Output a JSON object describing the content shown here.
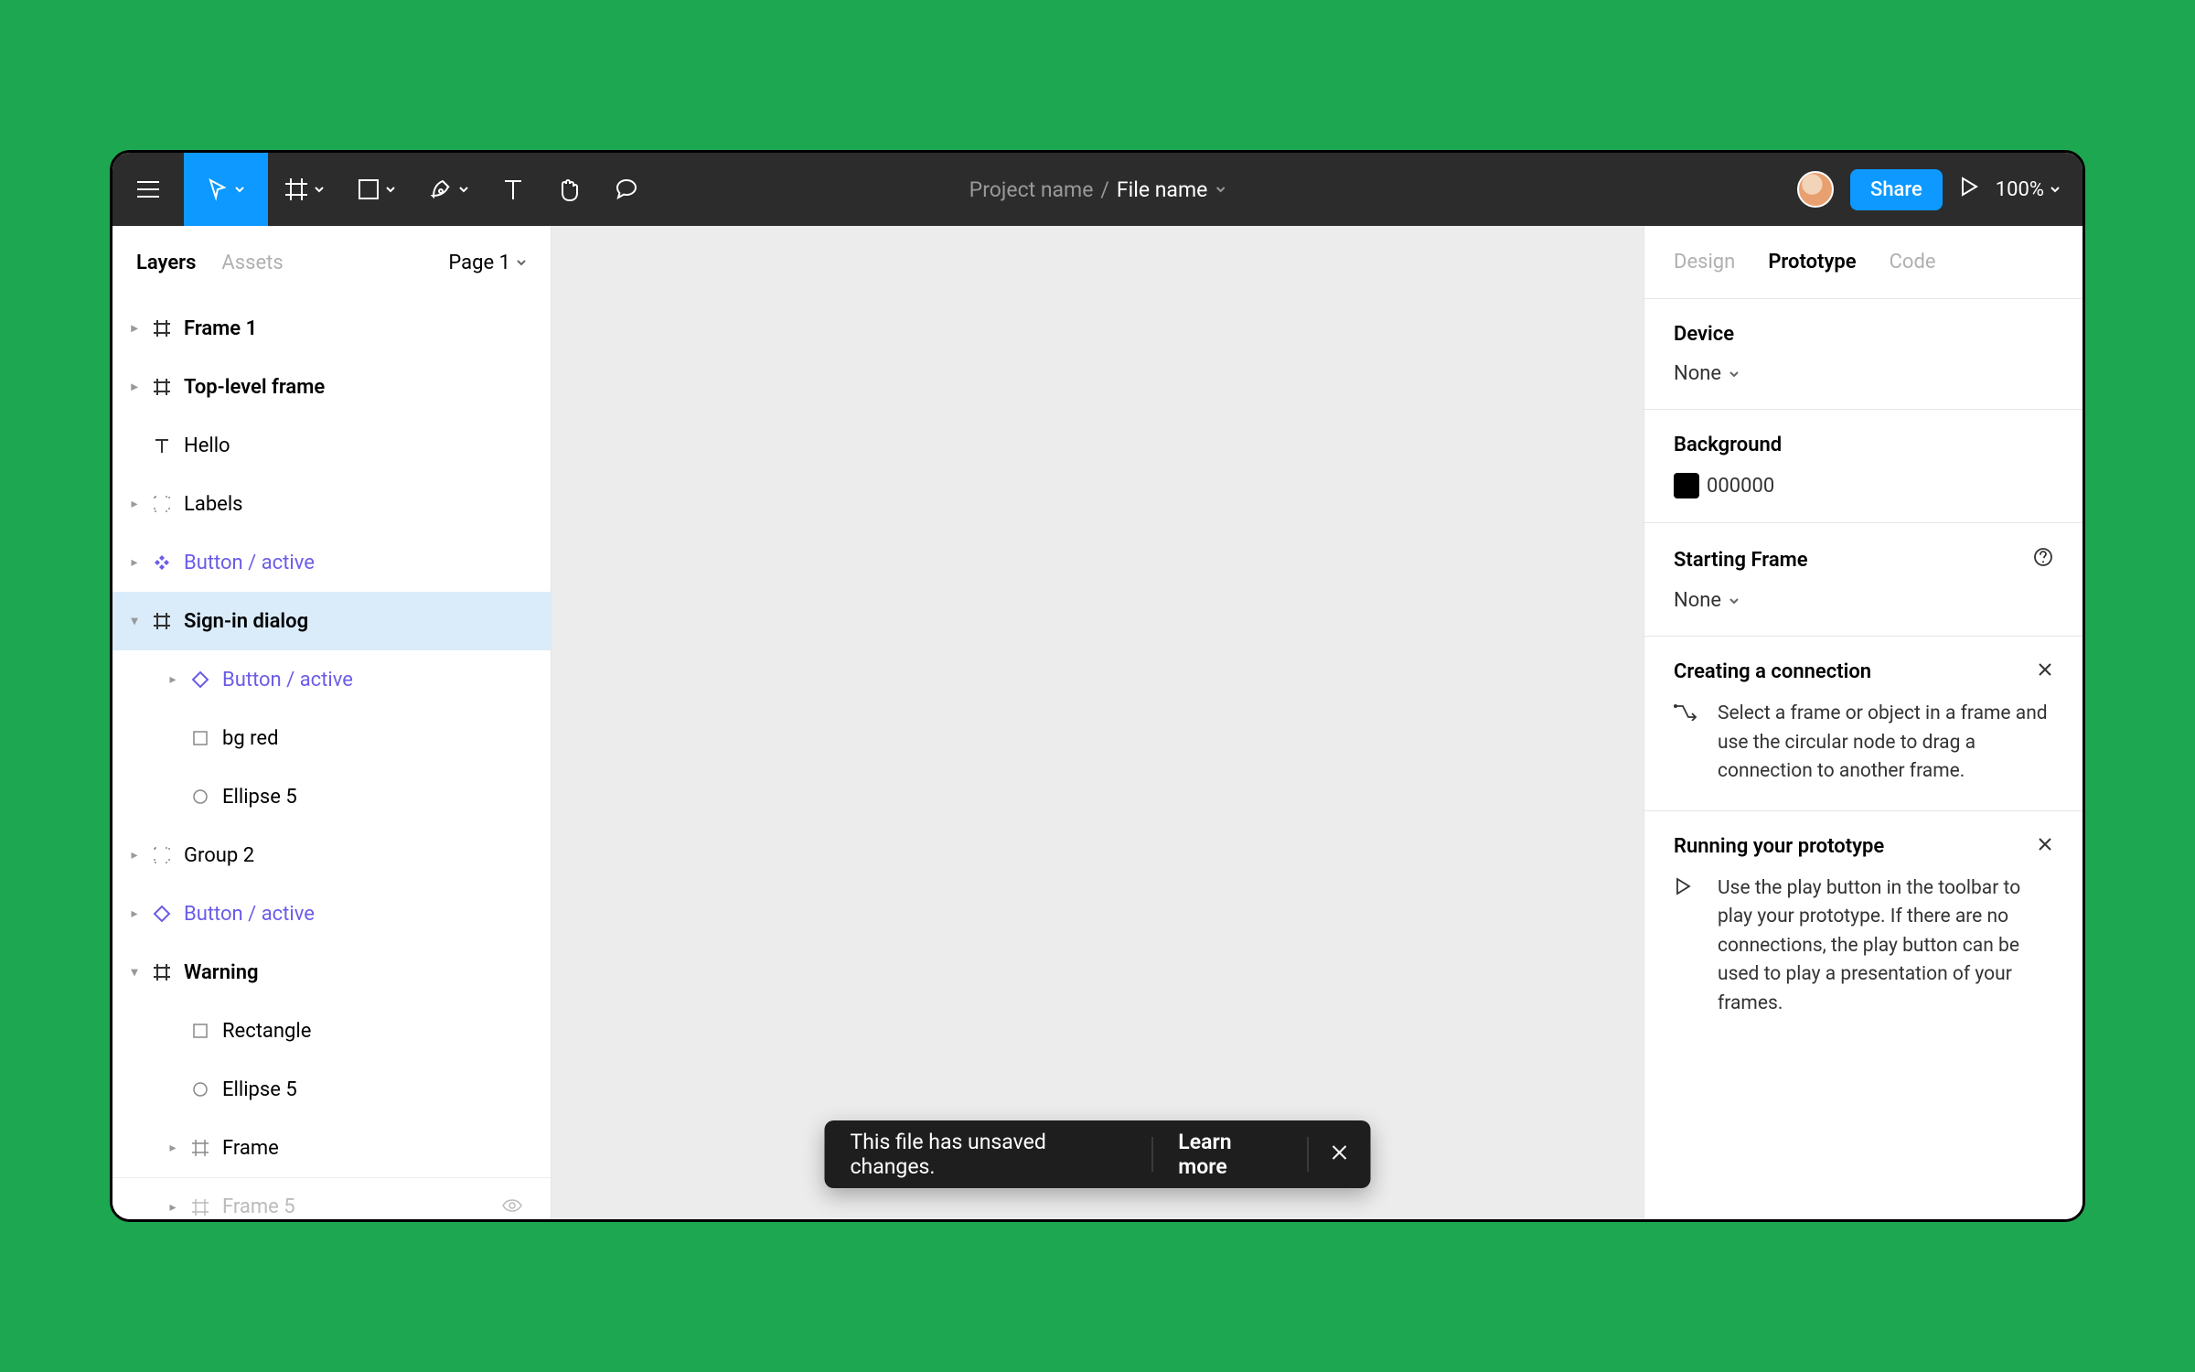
{
  "toolbar": {
    "project_name": "Project name",
    "file_name": "File name",
    "share_label": "Share",
    "zoom": "100%"
  },
  "left_panel": {
    "tabs": {
      "layers": "Layers",
      "assets": "Assets"
    },
    "page_selector": "Page 1",
    "layers": [
      {
        "label": "Frame 1"
      },
      {
        "label": "Top-level frame"
      },
      {
        "label": "Hello"
      },
      {
        "label": "Labels"
      },
      {
        "label": "Button / active"
      },
      {
        "label": "Sign-in dialog"
      },
      {
        "label": "Button / active"
      },
      {
        "label": "bg red"
      },
      {
        "label": "Ellipse 5"
      },
      {
        "label": "Group 2"
      },
      {
        "label": "Button / active"
      },
      {
        "label": "Warning"
      },
      {
        "label": "Rectangle"
      },
      {
        "label": "Ellipse 5"
      },
      {
        "label": "Frame"
      },
      {
        "label": "Frame 5"
      }
    ]
  },
  "right_panel": {
    "tabs": {
      "design": "Design",
      "prototype": "Prototype",
      "code": "Code"
    },
    "device": {
      "heading": "Device",
      "value": "None"
    },
    "background": {
      "heading": "Background",
      "value": "000000",
      "color": "#000000"
    },
    "starting_frame": {
      "heading": "Starting Frame",
      "value": "None"
    },
    "hints": [
      {
        "title": "Creating a connection",
        "body": "Select a frame or object in a frame and use the circular node to drag a connection to another frame."
      },
      {
        "title": "Running your prototype",
        "body": "Use the play button in the toolbar to play your prototype. If there are no connections, the play button can be used to play a presentation of your frames."
      }
    ]
  },
  "toast": {
    "message": "This file has unsaved changes.",
    "learn_more": "Learn more"
  }
}
